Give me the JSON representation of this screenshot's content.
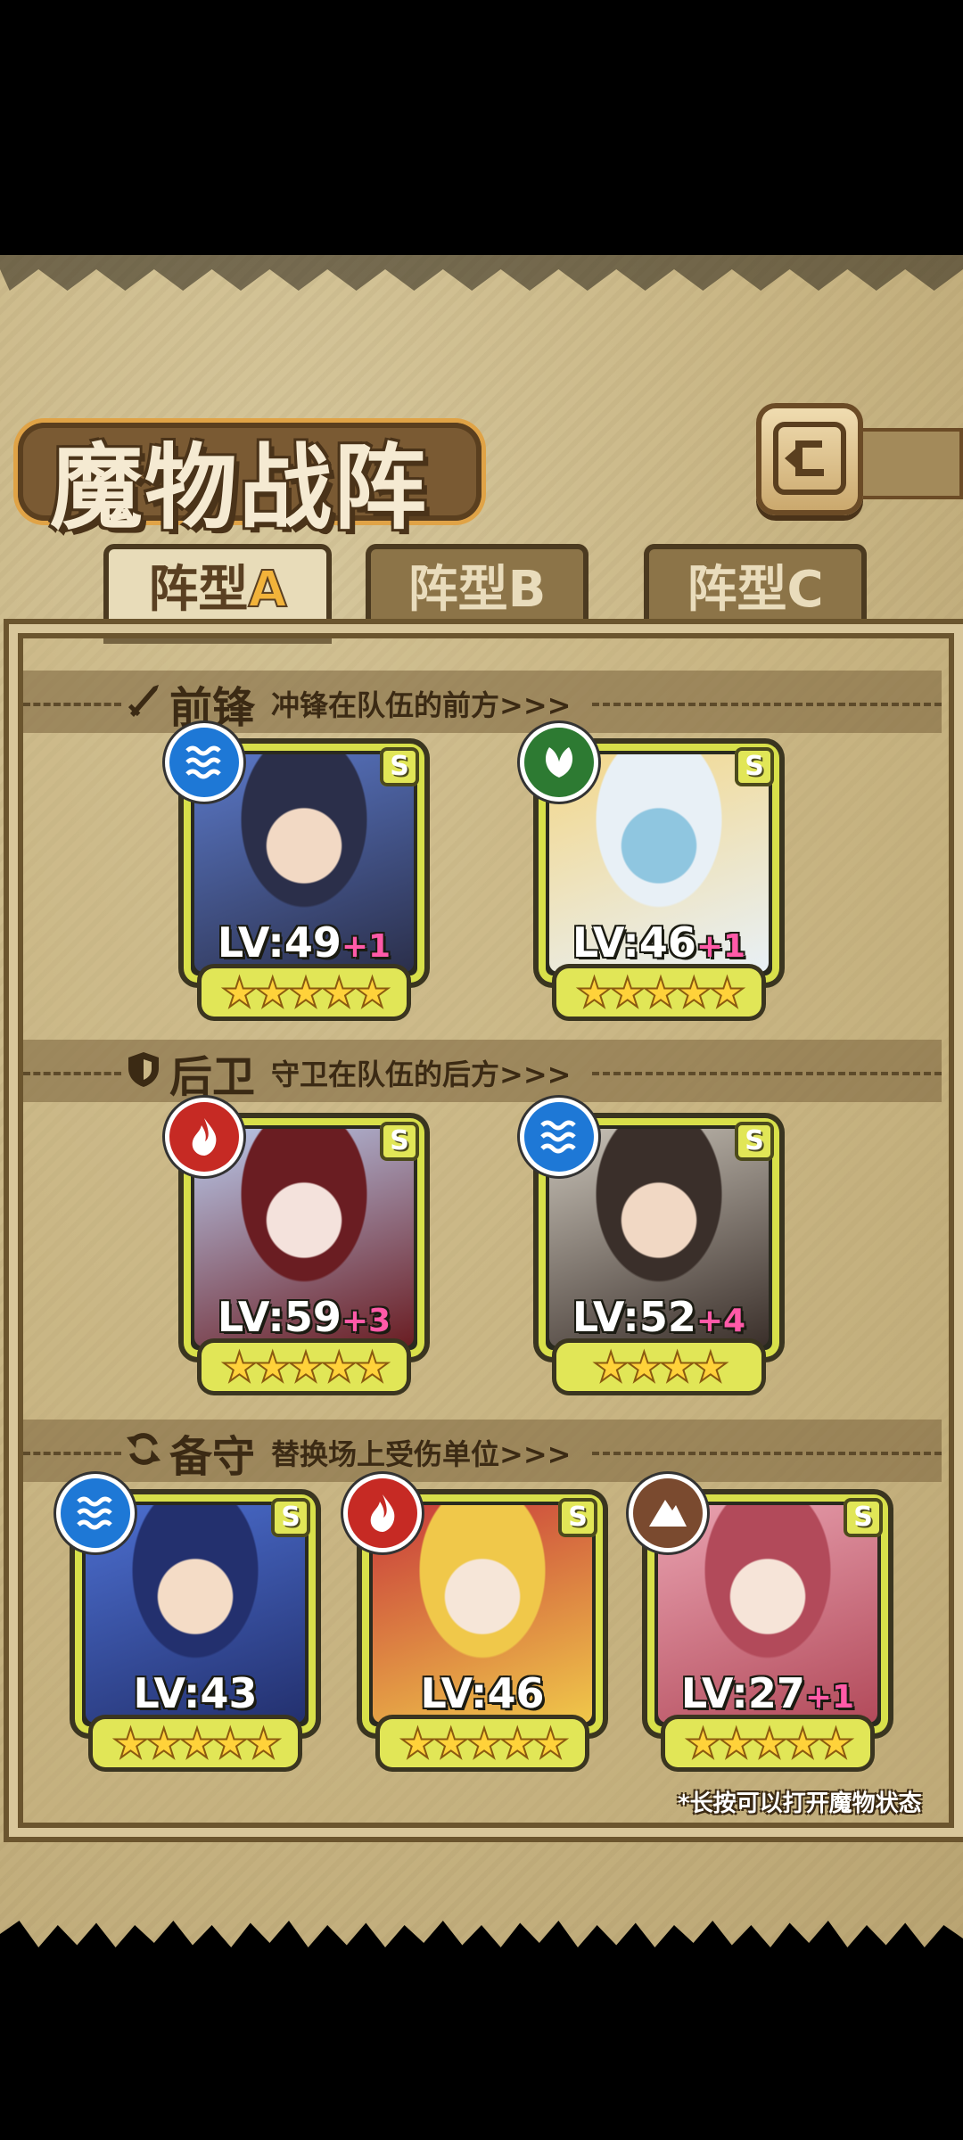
{
  "header": {
    "title": "魔物战阵",
    "back_icon": "back-arrow-icon"
  },
  "tabs": [
    {
      "prefix": "阵型",
      "suffix": "A",
      "active": true
    },
    {
      "prefix": "阵型",
      "suffix": "B",
      "active": false
    },
    {
      "prefix": "阵型",
      "suffix": "C",
      "active": false
    }
  ],
  "sections": {
    "front": {
      "title": "前锋",
      "subtitle": "冲锋在队伍的前方>>>",
      "icon": "sword-icon"
    },
    "rear": {
      "title": "后卫",
      "subtitle": "守卫在队伍的后方>>>",
      "icon": "shield-icon"
    },
    "reserve": {
      "title": "备守",
      "subtitle": "替换场上受伤单位>>>",
      "icon": "swap-icon"
    }
  },
  "units": {
    "front": [
      {
        "level": "LV:49",
        "bonus": "+1",
        "element": "water",
        "grade": "S",
        "stars": 5,
        "colors": [
          "#2b2f4a",
          "#5a78c8",
          "#f2d9c4"
        ]
      },
      {
        "level": "LV:46",
        "bonus": "+1",
        "element": "nature",
        "grade": "S",
        "stars": 5,
        "colors": [
          "#e8f0f6",
          "#f3d78a",
          "#8fc6e0"
        ]
      }
    ],
    "rear": [
      {
        "level": "LV:59",
        "bonus": "+3",
        "element": "fire",
        "grade": "S",
        "stars": 5,
        "colors": [
          "#6a1d22",
          "#b9c8ea",
          "#f4e2dc"
        ]
      },
      {
        "level": "LV:52",
        "bonus": "+4",
        "element": "water",
        "grade": "S",
        "stars": 4,
        "colors": [
          "#3a2f2a",
          "#c9c3b8",
          "#f1d8c4"
        ]
      }
    ],
    "reserve": [
      {
        "level": "LV:43",
        "bonus": "",
        "element": "water",
        "grade": "S",
        "stars": 5,
        "colors": [
          "#23306e",
          "#4c6fd0",
          "#f4dcc6"
        ]
      },
      {
        "level": "LV:46",
        "bonus": "",
        "element": "fire",
        "grade": "S",
        "stars": 5,
        "colors": [
          "#f0c84a",
          "#c83a3a",
          "#f6e6d8"
        ]
      },
      {
        "level": "LV:27",
        "bonus": "+1",
        "element": "earth",
        "grade": "S",
        "stars": 5,
        "colors": [
          "#b24a5a",
          "#e9a2b0",
          "#f6e4d8"
        ]
      }
    ]
  },
  "hint": "*长按可以打开魔物状态"
}
